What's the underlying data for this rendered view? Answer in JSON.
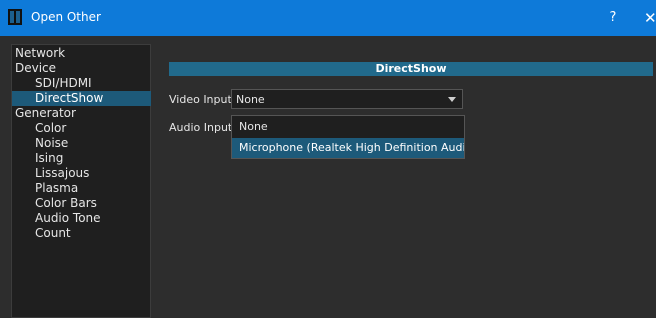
{
  "window": {
    "title": "Open Other",
    "help_label": "?",
    "close_label": "✕",
    "icon": "app-window-icon"
  },
  "sidebar": {
    "items": [
      {
        "label": "Network",
        "level": 0
      },
      {
        "label": "Device",
        "level": 0
      },
      {
        "label": "SDI/HDMI",
        "level": 1
      },
      {
        "label": "DirectShow",
        "level": 1,
        "selected": true
      },
      {
        "label": "Generator",
        "level": 0
      },
      {
        "label": "Color",
        "level": 1
      },
      {
        "label": "Noise",
        "level": 1
      },
      {
        "label": "Ising",
        "level": 1
      },
      {
        "label": "Lissajous",
        "level": 1
      },
      {
        "label": "Plasma",
        "level": 1
      },
      {
        "label": "Color Bars",
        "level": 1
      },
      {
        "label": "Audio Tone",
        "level": 1
      },
      {
        "label": "Count",
        "level": 1
      }
    ]
  },
  "panel": {
    "header": "DirectShow",
    "video_input": {
      "label": "Video Input",
      "value": "None"
    },
    "audio_input": {
      "label": "Audio Input",
      "options": [
        {
          "label": "None"
        },
        {
          "label": "Microphone (Realtek High Definition Audio)",
          "highlighted": true
        }
      ]
    }
  },
  "colors": {
    "titlebar": "#0e7ad9",
    "selection": "#1d5a7a",
    "header": "#216a8c",
    "background": "#2d2d2d"
  }
}
